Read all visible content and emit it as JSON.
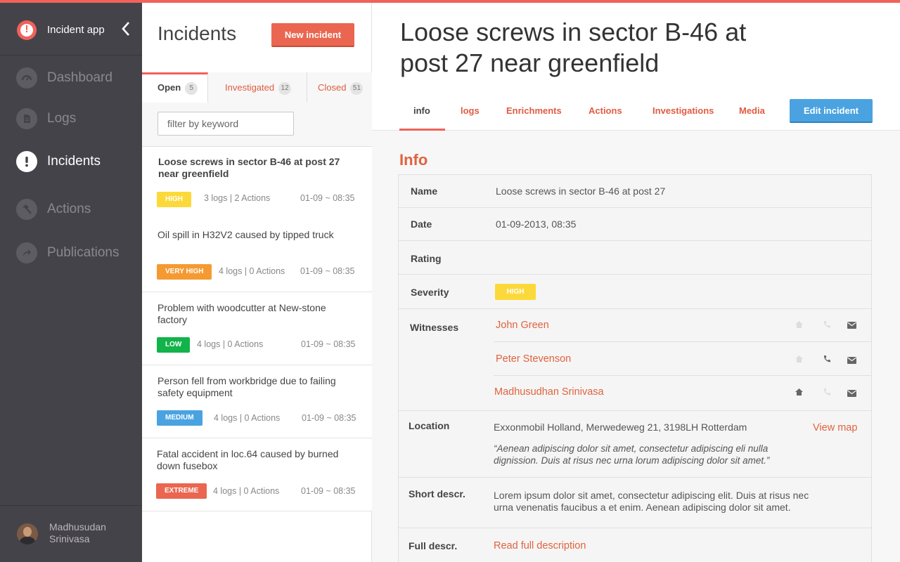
{
  "app": {
    "name": "Incident app",
    "accent": "#f0625a"
  },
  "nav": {
    "items": [
      {
        "label": "Dashboard",
        "icon": "gauge-icon",
        "active": false
      },
      {
        "label": "Logs",
        "icon": "document-icon",
        "active": false
      },
      {
        "label": "Incidents",
        "icon": "exclamation-icon",
        "active": true
      },
      {
        "label": "Actions",
        "icon": "hammer-icon",
        "active": false
      },
      {
        "label": "Publications",
        "icon": "share-icon",
        "active": false
      }
    ]
  },
  "user": {
    "name": "Madhusudan Srinivasa"
  },
  "list": {
    "title": "Incidents",
    "new_button": "New incident",
    "filter_placeholder": "filter by keyword",
    "tabs": [
      {
        "label": "Open",
        "count": "5"
      },
      {
        "label": "Investigated",
        "count": "12"
      },
      {
        "label": "Closed",
        "count": "51"
      }
    ],
    "incidents": [
      {
        "title": "Loose screws in sector B-46 at post 27 near greenfield",
        "severity": "HIGH",
        "color": "#fcd93a",
        "meta": "3 logs | 2 Actions",
        "time": "01-09 ~ 08:35"
      },
      {
        "title": "Oil spill in H32V2 caused by tipped truck",
        "severity": "VERY HIGH",
        "color": "#f59a32",
        "meta": "4 logs | 0 Actions",
        "time": "01-09 ~ 08:35"
      },
      {
        "title": "Problem with woodcutter at New-stone factory",
        "severity": "LOW",
        "color": "#12b34a",
        "meta": "4 logs | 0 Actions",
        "time": "01-09 ~ 08:35"
      },
      {
        "title": "Person fell from workbridge due to failing safety equipment",
        "severity": "MEDIUM",
        "color": "#4aa3e0",
        "meta": "4 logs | 0 Actions",
        "time": "01-09 ~ 08:35"
      },
      {
        "title": "Fatal accident in loc.64 caused by burned down fusebox",
        "severity": "EXTREME",
        "color": "#ea6650",
        "meta": "4 logs | 0 Actions",
        "time": "01-09 ~ 08:35"
      }
    ]
  },
  "detail": {
    "title": "Loose screws in sector B-46 at post 27 near greenfield",
    "tabs": [
      "info",
      "logs",
      "Enrichments",
      "Actions",
      "Investigations",
      "Media"
    ],
    "edit_button": "Edit incident",
    "section_title": "Info",
    "labels": {
      "name": "Name",
      "date": "Date",
      "rating": "Rating",
      "severity": "Severity",
      "witnesses": "Witnesses",
      "location": "Location",
      "short": "Short descr.",
      "full": "Full descr."
    },
    "name": "Loose screws in sector B-46 at post 27",
    "date": "01-09-2013, 08:35",
    "severity": "HIGH",
    "witnesses": [
      {
        "name": "John Green",
        "home": false,
        "phone": false,
        "mail": true
      },
      {
        "name": "Peter Stevenson",
        "home": false,
        "phone": true,
        "mail": true
      },
      {
        "name": "Madhusudhan Srinivasa",
        "home": true,
        "phone": false,
        "mail": true
      }
    ],
    "location": "Exxonmobil Holland, Merwedeweg 21, 3198LH Rotterdam",
    "view_map": "View map",
    "location_quote": "“Aenean adipiscing dolor sit amet, consectetur adipiscing eli nulla dignission. Duis at risus nec urna lorum adipiscing dolor sit amet.”",
    "short_descr": "Lorem ipsum dolor sit amet, consectetur adipiscing elit. Duis at risus nec urna venenatis faucibus a et enim. Aenean adipiscing dolor sit amet.",
    "full_link": "Read full description"
  }
}
